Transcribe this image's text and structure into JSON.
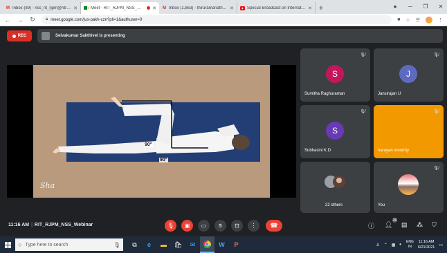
{
  "browser": {
    "tabs": [
      {
        "title": "Inbox (89) - nss_rit_rjpm@ritrjpm...",
        "favicon": "gmail-icon",
        "color": "#d93025",
        "active": false
      },
      {
        "title": "Meet - RIT_RJPM_NSS_Web...",
        "favicon": "meet-icon",
        "color": "#00832d",
        "active": true,
        "recording": true
      },
      {
        "title": "Inbox (1,863) - thiruramanathan...",
        "favicon": "gmail-icon",
        "color": "#d93025",
        "active": false
      },
      {
        "title": "Special Broadcast on Internatio...",
        "favicon": "youtube-icon",
        "color": "#ff0000",
        "active": false
      }
    ],
    "url": "meet.google.com/jus-pakh-czn?pli=1&authuser=0"
  },
  "meet": {
    "rec_label": "REC",
    "presenting_text": "Selvakumar Sakthivel is presenting",
    "video_annotations": [
      "90°",
      "90°"
    ],
    "watermark": "Sha",
    "participants": [
      {
        "name": "Sumitha Raghuraman",
        "initial": "S",
        "color": "#c2185b",
        "muted": true
      },
      {
        "name": "Jansirajan U",
        "initial": "J",
        "color": "#5c6bc0",
        "muted": true
      },
      {
        "name": "Subhasini K.D",
        "initial": "S",
        "color": "#673ab7",
        "muted": true
      },
      {
        "name": "narayan moorthy",
        "initial": "",
        "color": "#f29900",
        "muted": true
      },
      {
        "name": "22 others",
        "initial": "",
        "color": "#3c4043",
        "muted": false
      },
      {
        "name": "You",
        "initial": "",
        "color": "#3c4043",
        "muted": true
      }
    ],
    "time": "11:16 AM",
    "meeting_name": "RIT_RJPM_NSS_Webinar",
    "participant_count": "26"
  },
  "taskbar": {
    "search_placeholder": "Type here to search",
    "lang_line1": "ENG",
    "lang_line2": "IN",
    "time": "11:16 AM",
    "date": "6/21/2021"
  }
}
